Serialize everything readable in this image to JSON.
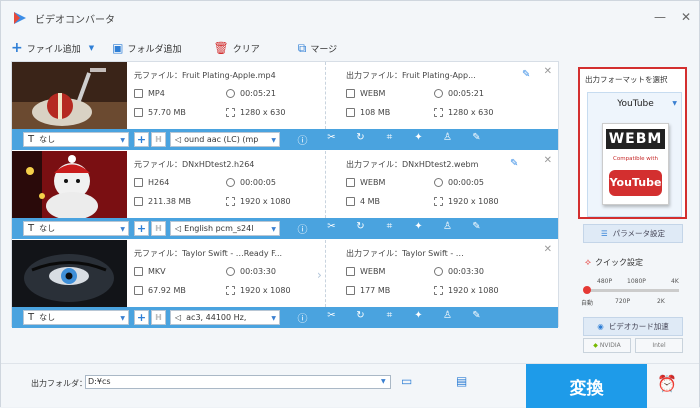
{
  "window": {
    "title": "ビデオコンバータ"
  },
  "toolbar": {
    "add_file": "ファイル追加",
    "add_folder": "フォルダ追加",
    "clear": "クリア",
    "merge": "マージ"
  },
  "items": [
    {
      "source_label": "元ファイル：Fruit Plating-Apple.mp4",
      "src_format": "MP4",
      "src_duration": "00:05:21",
      "src_size": "57.70 MB",
      "src_resolution": "1280 x 630",
      "output_label": "出力ファイル：Fruit Plating-App...",
      "out_format": "WEBM",
      "out_duration": "00:05:21",
      "out_size": "108 MB",
      "out_resolution": "1280 x 630",
      "subtitle": "なし",
      "audio": "ound aac (LC) (mp"
    },
    {
      "source_label": "元ファイル：DNxHDtest2.h264",
      "src_format": "H264",
      "src_duration": "00:00:05",
      "src_size": "211.38 MB",
      "src_resolution": "1920 x 1080",
      "output_label": "出力ファイル：DNxHDtest2.webm",
      "out_format": "WEBM",
      "out_duration": "00:00:05",
      "out_size": "4 MB",
      "out_resolution": "1920 x 1080",
      "subtitle": "なし",
      "audio": "English pcm_s24l"
    },
    {
      "source_label": "元ファイル：Taylor Swift - …Ready F...",
      "src_format": "MKV",
      "src_duration": "00:03:30",
      "src_size": "67.92 MB",
      "src_resolution": "1920 x 1080",
      "output_label": "出力ファイル：Taylor Swift - …",
      "out_format": "WEBM",
      "out_duration": "00:03:30",
      "out_size": "177 MB",
      "out_resolution": "1920 x 1080",
      "subtitle": "なし",
      "audio": "ac3, 44100 Hz,"
    }
  ],
  "output_format": {
    "title": "出力フォーマットを選択",
    "selected": "YouTube",
    "logo_top": "WEBM",
    "logo_middle": "Compatible with",
    "logo_bottom": "YouTube"
  },
  "params": {
    "parameter_settings": "パラメータ設定",
    "quick_settings": "クイック設定",
    "slider_top_labels": [
      "480P",
      "1080P",
      "4K"
    ],
    "slider_bottom_labels": [
      "自動",
      "720P",
      "2K"
    ],
    "slider_level_percent": 0,
    "video_card_accel": "ビデオカード加速",
    "nvidia": "NVIDIA",
    "intel": "Intel"
  },
  "bottom": {
    "output_folder_label": "出力フォルダ：",
    "output_folder_value": "D:¥cs",
    "convert": "変換"
  },
  "colors": {
    "accent": "#1e9be9",
    "bar": "#4aa3df",
    "highlight_border": "#d32f2f"
  }
}
